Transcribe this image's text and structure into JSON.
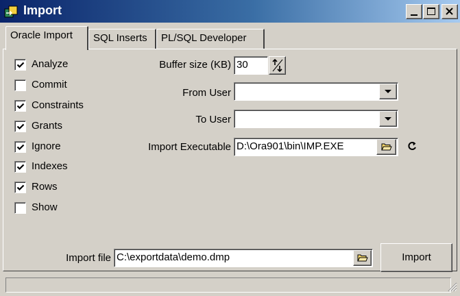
{
  "window": {
    "title": "Import",
    "controls": [
      "minimize",
      "maximize",
      "close"
    ]
  },
  "tabs": [
    {
      "label": "Oracle Import",
      "active": true
    },
    {
      "label": "SQL Inserts",
      "active": false
    },
    {
      "label": "PL/SQL Developer",
      "active": false
    }
  ],
  "options": [
    {
      "label": "Analyze",
      "checked": true
    },
    {
      "label": "Commit",
      "checked": false
    },
    {
      "label": "Constraints",
      "checked": true
    },
    {
      "label": "Grants",
      "checked": true
    },
    {
      "label": "Ignore",
      "checked": true
    },
    {
      "label": "Indexes",
      "checked": true
    },
    {
      "label": "Rows",
      "checked": true
    },
    {
      "label": "Show",
      "checked": false
    }
  ],
  "buffer_size": {
    "label": "Buffer size (KB)",
    "value": "30"
  },
  "from_user": {
    "label": "From User",
    "value": ""
  },
  "to_user": {
    "label": "To User",
    "value": ""
  },
  "import_executable": {
    "label": "Import Executable",
    "value": "D:\\Ora901\\bin\\IMP.EXE"
  },
  "import_file": {
    "label": "Import file",
    "value": "C:\\exportdata\\demo.dmp"
  },
  "import_button": {
    "label": "Import"
  },
  "icons": {
    "app": "import-app-icon",
    "folder": "folder-open-icon",
    "refresh": "refresh-icon",
    "spin": "spin-updown-icon",
    "dropdown": "chevron-down-icon",
    "grip": "resize-grip-icon"
  },
  "colors": {
    "titlebar_start": "#0a246a",
    "titlebar_end": "#a6caf0",
    "face": "#d4d0c8"
  }
}
